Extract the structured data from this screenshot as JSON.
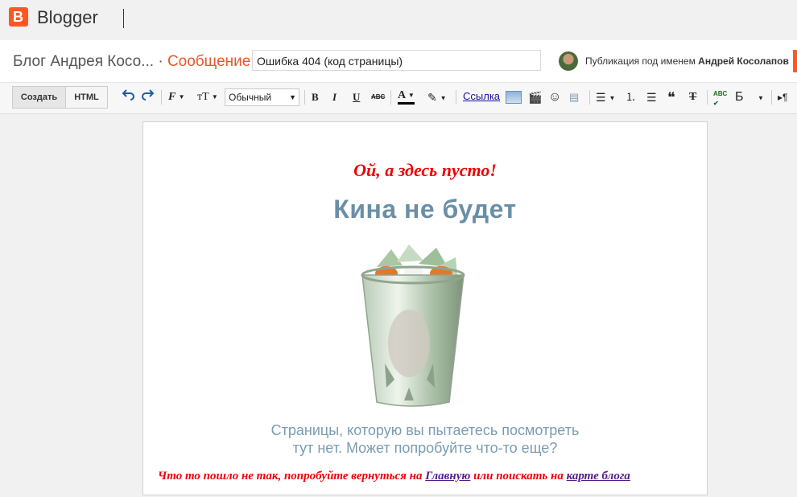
{
  "app": {
    "brand": "Blogger"
  },
  "post": {
    "blog_name": "Блог Андрея Косо...",
    "separator": "·",
    "section": "Сообщение",
    "title_value": "Ошибка 404 (код страницы)",
    "publish_as_prefix": "Публикация под именем",
    "author": "Андрей Косолапов"
  },
  "toolbar": {
    "create_label": "Создать",
    "html_label": "HTML",
    "format_value": "Обычный",
    "link_label": "Ссылка",
    "quote_glyph": "❝",
    "spell_glyph": "ABC",
    "lang_glyph": "Б"
  },
  "content": {
    "heading": "Ой, а здесь пусто!",
    "image_title": "Кина не будет",
    "image_caption_line1": "Страницы, которую вы пытаетесь посмотреть",
    "image_caption_line2": "тут нет. Может попробуйте что-то еще?",
    "bottom_prefix": "Что то пошло не так, попробуйте вернуться на",
    "home_link": "Главную",
    "bottom_middle": "или поискать на",
    "sitemap_link": "карте блога"
  },
  "colors": {
    "accent": "#ff5722",
    "section": "#e8572c",
    "heading_red": "#e00000",
    "link_purple": "#551a8b",
    "image_text": "#6a8fa6"
  }
}
